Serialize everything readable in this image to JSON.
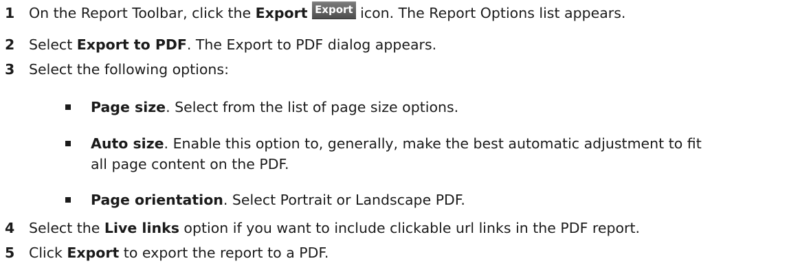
{
  "steps": [
    {
      "num": "1",
      "pre": "On the Report Toolbar, click the ",
      "bold": "Export",
      "icon_label": "Export",
      "post": " icon. The Report Options list appears."
    },
    {
      "num": "2",
      "pre": "Select ",
      "bold": "Export to PDF",
      "post": ". The Export to PDF dialog appears."
    },
    {
      "num": "3",
      "text": "Select the following options:"
    },
    {
      "num": "4",
      "pre": "Select the ",
      "bold": "Live links",
      "post": " option if you want to include clickable url links in the PDF report."
    },
    {
      "num": "5",
      "pre": "Click ",
      "bold": "Export",
      "post": " to export the report to a PDF."
    }
  ],
  "options": [
    {
      "bold": "Page size",
      "text": ". Select from the list of page size options."
    },
    {
      "bold": "Auto size",
      "text": ". Enable this option to, generally, make the best automatic adjustment to fit",
      "text_cont": "all page content on the PDF."
    },
    {
      "bold": "Page orientation",
      "text": ". Select Portrait or Landscape PDF."
    }
  ]
}
